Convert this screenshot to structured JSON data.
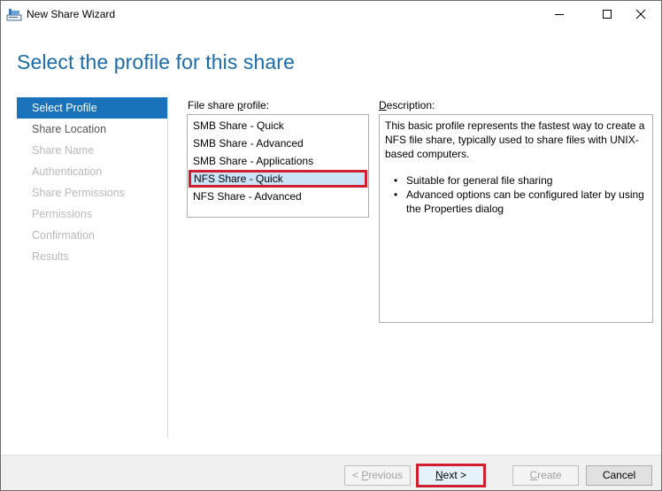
{
  "window": {
    "title": "New Share Wizard",
    "controls": {
      "minimize": "minimize",
      "maximize": "maximize",
      "close": "close"
    }
  },
  "header": {
    "title": "Select the profile for this share"
  },
  "sidebar": {
    "items": [
      {
        "label": "Select Profile",
        "state": "active"
      },
      {
        "label": "Share Location",
        "state": "enabled"
      },
      {
        "label": "Share Name",
        "state": "disabled"
      },
      {
        "label": "Authentication",
        "state": "disabled"
      },
      {
        "label": "Share Permissions",
        "state": "disabled"
      },
      {
        "label": "Permissions",
        "state": "disabled"
      },
      {
        "label": "Confirmation",
        "state": "disabled"
      },
      {
        "label": "Results",
        "state": "disabled"
      }
    ]
  },
  "profile": {
    "label_prefix": "File share ",
    "label_underlined": "p",
    "label_suffix": "rofile:",
    "items": [
      "SMB Share - Quick",
      "SMB Share - Advanced",
      "SMB Share - Applications",
      "NFS Share - Quick",
      "NFS Share - Advanced"
    ],
    "selected": "NFS Share - Quick"
  },
  "description": {
    "label_underlined": "D",
    "label_suffix": "escription:",
    "text": "This basic profile represents the fastest way to create a NFS file share, typically used to share files with UNIX-based computers.",
    "bullets": [
      "Suitable for general file sharing",
      "Advanced options can be configured later by using the Properties dialog"
    ]
  },
  "footer": {
    "previous": {
      "prefix": "< ",
      "underlined": "P",
      "suffix": "revious"
    },
    "next": {
      "underlined": "N",
      "suffix": "ext >"
    },
    "create": {
      "underlined": "C",
      "suffix": "reate"
    },
    "cancel": "Cancel"
  },
  "colors": {
    "accent": "#1a72bb",
    "title": "#1c6ca8",
    "highlight": "#d0202f",
    "selection": "#cce4f7"
  }
}
